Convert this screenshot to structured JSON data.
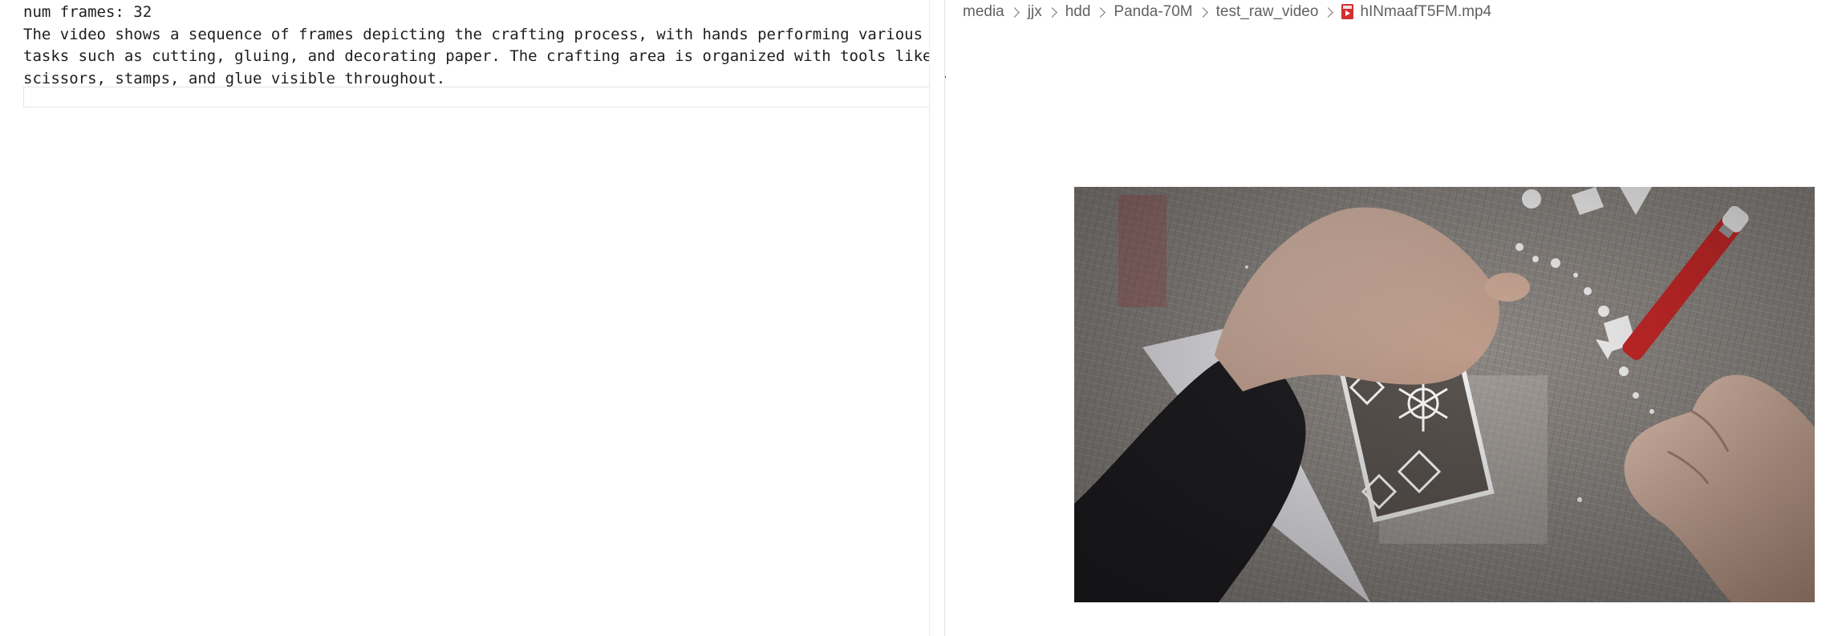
{
  "output": {
    "lines": [
      "num frames: 32",
      "The video shows a sequence of frames depicting the crafting process, with hands performing various",
      "tasks such as cutting, gluing, and decorating paper. The crafting area is organized with tools like",
      "scissors, stamps, and glue visible throughout."
    ]
  },
  "breadcrumb": {
    "items": [
      {
        "label": "media"
      },
      {
        "label": "jjx"
      },
      {
        "label": "hdd"
      },
      {
        "label": "Panda-70M"
      },
      {
        "label": "test_raw_video"
      }
    ],
    "file": {
      "label": "hINmaafT5FM.mp4",
      "icon": "video-file-icon"
    }
  },
  "colors": {
    "file_icon": "#d32f2f",
    "text": "#1e1e1e",
    "breadcrumb_text": "#616161"
  }
}
